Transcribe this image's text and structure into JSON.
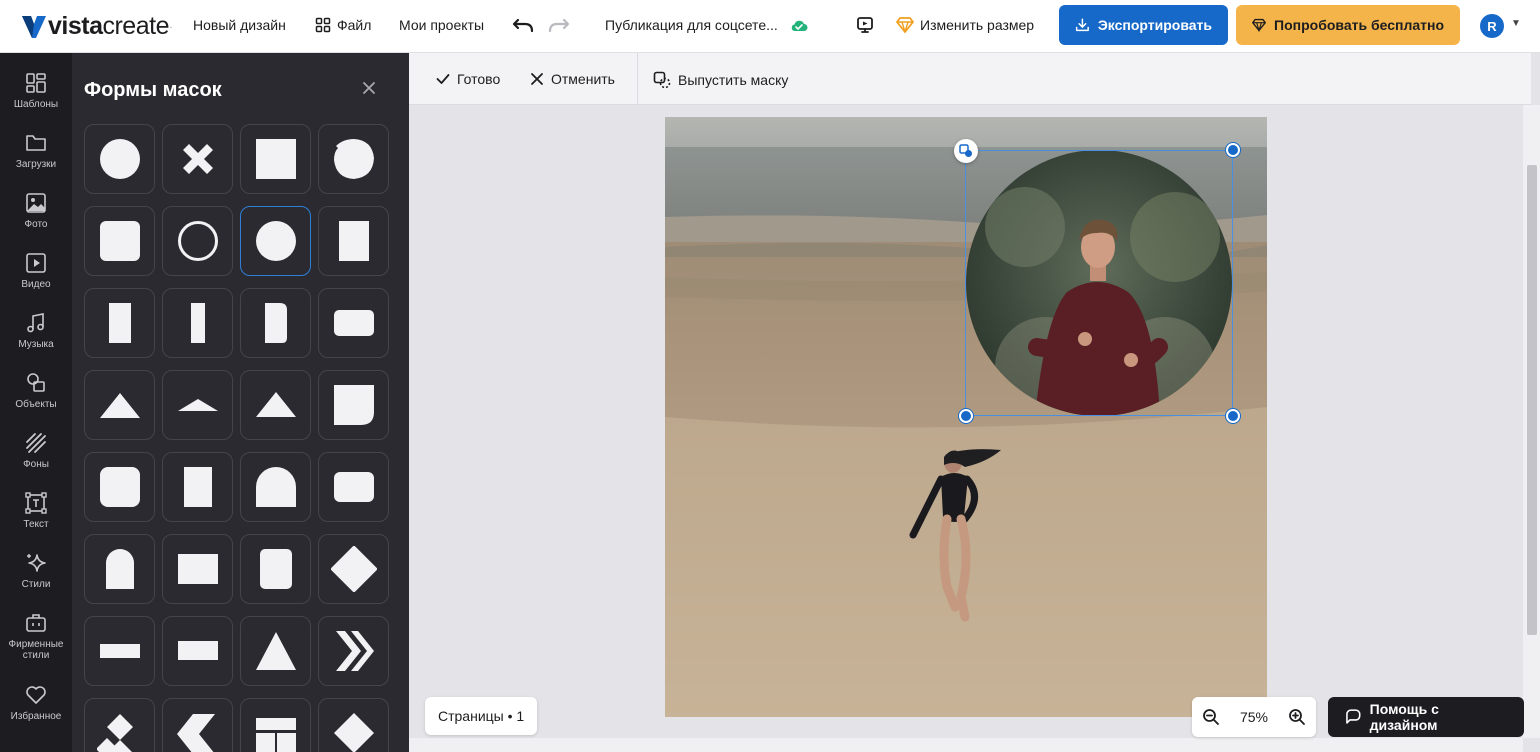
{
  "app": {
    "logo_bold": "vista",
    "logo_light": "create",
    "brand_color": "#1669c8"
  },
  "topbar": {
    "new_design": "Новый дизайн",
    "file": "Файл",
    "my_projects": "Мои проекты",
    "doc_title": "Публикация для соцсете...",
    "resize": "Изменить размер",
    "export": "Экспортировать",
    "try_free": "Попробовать бесплатно",
    "avatar_letter": "R"
  },
  "rail": {
    "items": [
      {
        "label": "Шаблоны",
        "icon": "templates-icon"
      },
      {
        "label": "Загрузки",
        "icon": "folder-icon"
      },
      {
        "label": "Фото",
        "icon": "photo-icon"
      },
      {
        "label": "Видео",
        "icon": "video-icon"
      },
      {
        "label": "Музыка",
        "icon": "music-icon"
      },
      {
        "label": "Объекты",
        "icon": "objects-icon"
      },
      {
        "label": "Фоны",
        "icon": "backgrounds-icon"
      },
      {
        "label": "Текст",
        "icon": "text-icon"
      },
      {
        "label": "Стили",
        "icon": "styles-icon"
      },
      {
        "label": "Фирменные стили",
        "icon": "brand-kit-icon"
      },
      {
        "label": "Избранное",
        "icon": "heart-icon"
      }
    ]
  },
  "panel": {
    "title": "Формы масок",
    "selected_index": 6
  },
  "edit_bar": {
    "done": "Готово",
    "cancel": "Отменить",
    "release_mask": "Выпустить маску"
  },
  "footer": {
    "pages": "Страницы • 1",
    "zoom": "75%",
    "help": "Помощь с дизайном"
  }
}
